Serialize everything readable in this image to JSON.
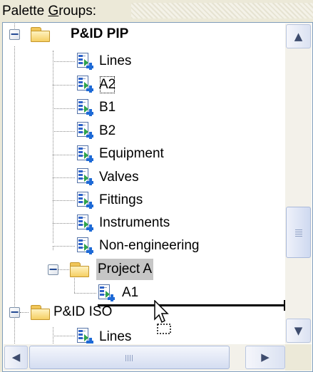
{
  "label": {
    "prefix": "Palette ",
    "mnemonic": "G",
    "suffix": "roups:"
  },
  "tree": {
    "group_pip": {
      "label": "P&ID PIP",
      "expander": "−"
    },
    "pip_items": [
      "Lines",
      "A2",
      "B1",
      "B2",
      "Equipment",
      "Valves",
      "Fittings",
      "Instruments",
      "Non-engineering"
    ],
    "project_a": {
      "label": "Project A",
      "expander": "−"
    },
    "project_a_items": [
      "A1"
    ],
    "group_iso": {
      "label": "P&ID ISO",
      "expander": "−"
    },
    "iso_items": [
      "Lines"
    ],
    "focused_item": "A2",
    "selected_item": "Project A"
  },
  "scrollbar": {
    "up_arrow": "▲",
    "down_arrow": "▼",
    "left_arrow": "◀",
    "right_arrow": "▶"
  },
  "icons": {
    "group": "folder-icon",
    "palette": "tool-palette-icon",
    "cursor": "drag-copy-cursor-icon"
  },
  "colors": {
    "selection": "#c6c6c6",
    "folder": "#f5cf63",
    "border": "#7f9db9"
  }
}
